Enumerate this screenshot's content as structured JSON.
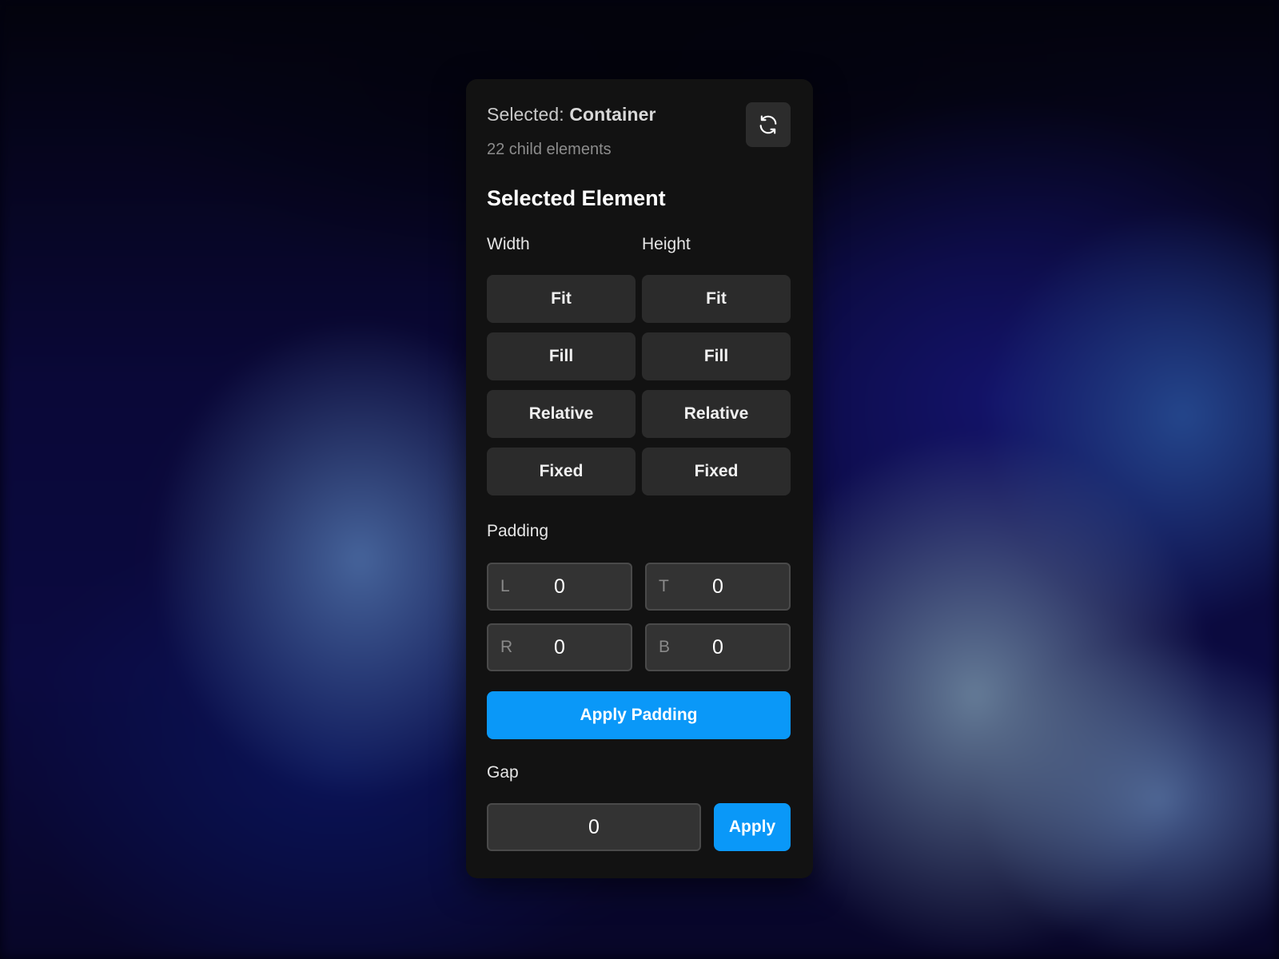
{
  "header": {
    "selected_prefix": "Selected:",
    "selected_name": "Container",
    "child_count": "22 child elements",
    "refresh_icon": "refresh-icon"
  },
  "section_title": "Selected Element",
  "sizing": {
    "width_label": "Width",
    "height_label": "Height",
    "width_options": [
      "Fit",
      "Fill",
      "Relative",
      "Fixed"
    ],
    "height_options": [
      "Fit",
      "Fill",
      "Relative",
      "Fixed"
    ]
  },
  "padding": {
    "label": "Padding",
    "fields": {
      "left": {
        "prefix": "L",
        "value": "0"
      },
      "top": {
        "prefix": "T",
        "value": "0"
      },
      "right": {
        "prefix": "R",
        "value": "0"
      },
      "bottom": {
        "prefix": "B",
        "value": "0"
      }
    },
    "apply_label": "Apply Padding"
  },
  "gap": {
    "label": "Gap",
    "value": "0",
    "apply_label": "Apply"
  },
  "colors": {
    "accent": "#0a98f8",
    "panel": "#121212",
    "button": "#2b2b2b"
  }
}
